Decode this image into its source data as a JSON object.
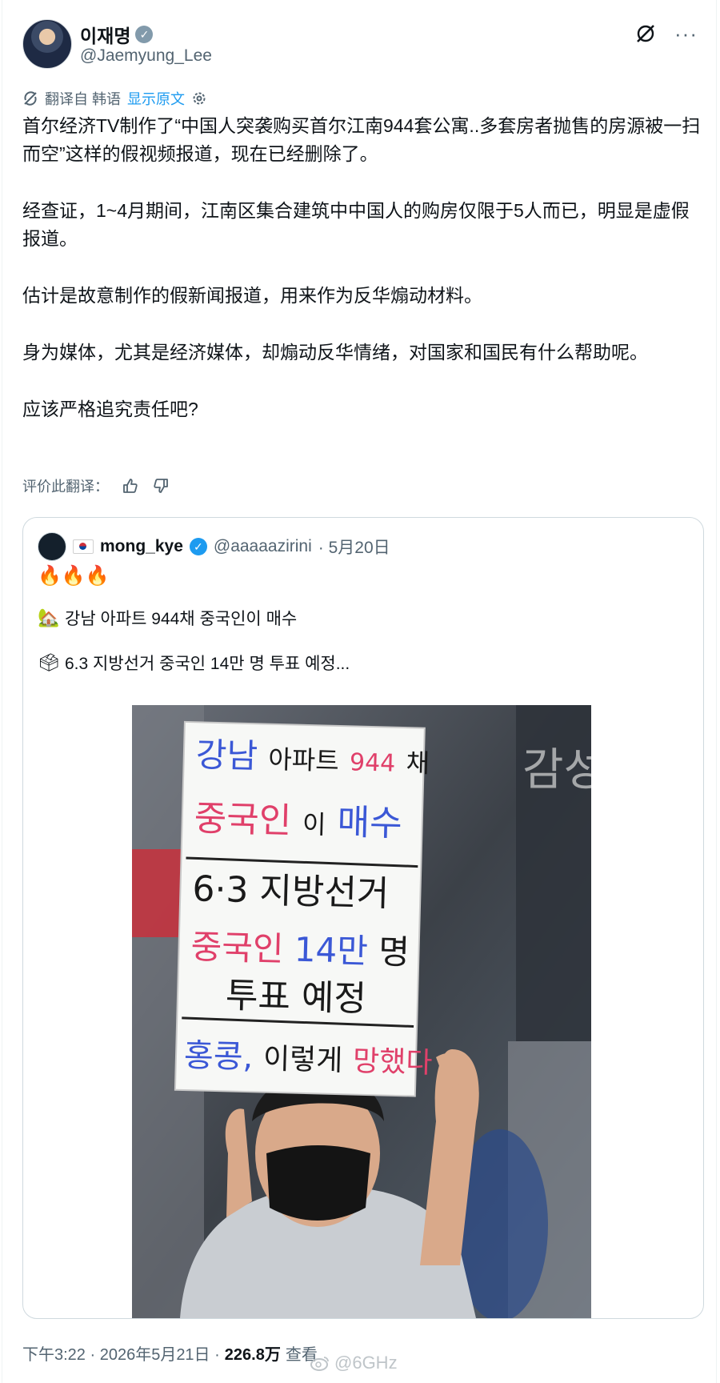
{
  "author": {
    "name": "이재명",
    "handle": "@Jaemyung_Lee"
  },
  "translation": {
    "source_label": "翻译自 韩语",
    "show_original": "显示原文",
    "rate_label": "评价此翻译："
  },
  "post": {
    "paragraphs": [
      "首尔经济TV制作了“中国人突袭购买首尔江南944套公寓..多套房者抛售的房源被一扫而空”这样的假视频报道，现在已经删除了。",
      "经查证，1~4月期间，江南区集合建筑中中国人的购房仅限于5人而已，明显是虚假报道。",
      "估计是故意制作的假新闻报道，用来作为反华煽动材料。",
      "身为媒体，尤其是经济媒体，却煽动反华情绪，对国家和国民有什么帮助呢。",
      "应该严格追究责任吧?"
    ]
  },
  "quote": {
    "name": "mong_kye",
    "handle": "@aaaaazirini",
    "date": "· 5月20日",
    "emojis": "🔥🔥🔥",
    "line1": "강남 아파트 944채 중국인이 매수",
    "line2": "6.3 지방선거 중국인 14만 명 투표 예정...",
    "sign": {
      "line1a": "강남",
      "line1b": "아파트",
      "line1c": "944",
      "line1d": "채",
      "line2a": "중국인",
      "line2b": "이",
      "line2c": "매수",
      "line3": "6·3 지방선거",
      "line4a": "중국인",
      "line4b": "14만",
      "line4c": "명",
      "line5": "투표 예정",
      "line6a": "홍콩,",
      "line6b": "이렇게",
      "line6c": "망했다"
    },
    "street_sign": "감성"
  },
  "footer": {
    "time": "下午3:22 · 2026年5月21日 ·",
    "views": "226.8万",
    "views_label": "查看",
    "watermark": "@6GHz"
  },
  "colors": {
    "link": "#1d9bf0",
    "muted": "#536471",
    "sign_blue": "#3b58d6",
    "sign_red": "#e0406a"
  }
}
